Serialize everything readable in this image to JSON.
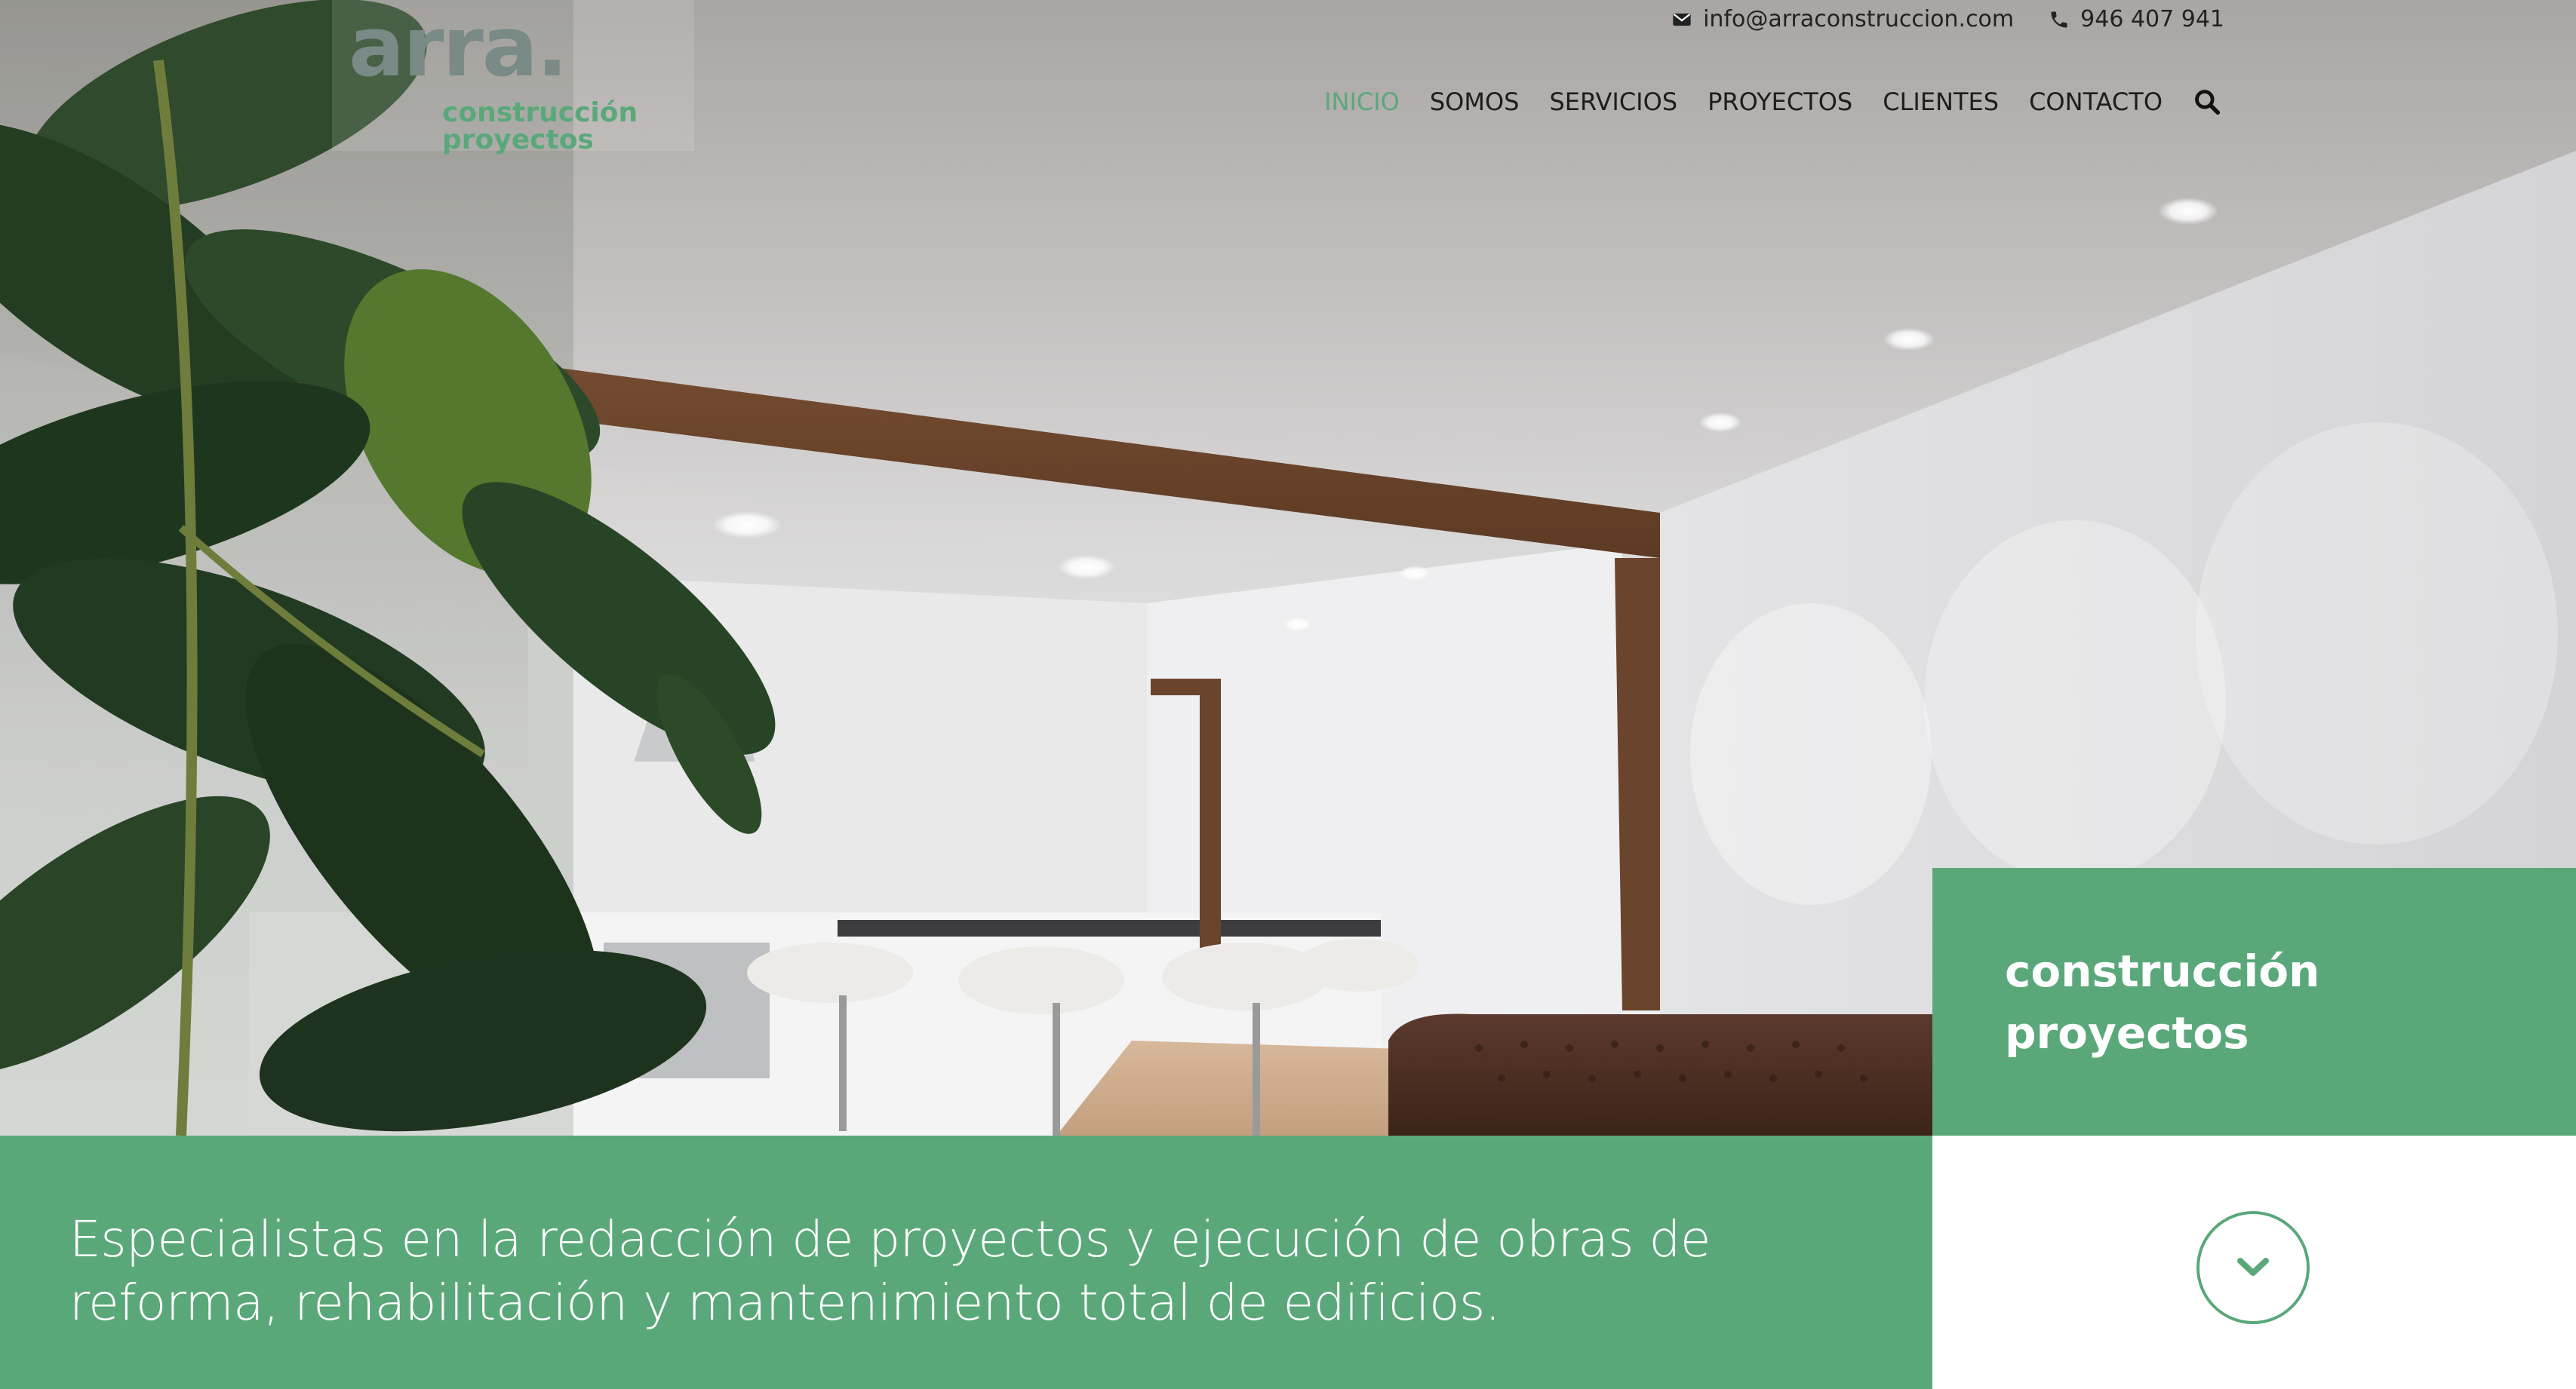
{
  "brand": {
    "name": "arra.",
    "line1": "construcción",
    "line2": "proyectos"
  },
  "topbar": {
    "email_icon": "envelope-icon",
    "email": "info@arraconstruccion.com",
    "phone_icon": "phone-icon",
    "phone": "946 407 941"
  },
  "nav": {
    "items": [
      {
        "label": "INICIO",
        "active": true
      },
      {
        "label": "SOMOS"
      },
      {
        "label": "SERVICIOS"
      },
      {
        "label": "PROYECTOS"
      },
      {
        "label": "CLIENTES"
      },
      {
        "label": "CONTACTO"
      }
    ],
    "search_icon": "search-icon"
  },
  "hero_panel": {
    "line1": "construcción",
    "line2": "proyectos"
  },
  "band": {
    "slogan": "Especialistas en la redacción de proyectos y ejecución de obras de reforma, rehabilitación y mantenimiento total de edificios."
  },
  "scroll_button": {
    "icon": "chevron-down-icon"
  },
  "colors": {
    "accent": "#5aa87a",
    "text_dark": "#1d1d1d",
    "white": "#ffffff"
  }
}
